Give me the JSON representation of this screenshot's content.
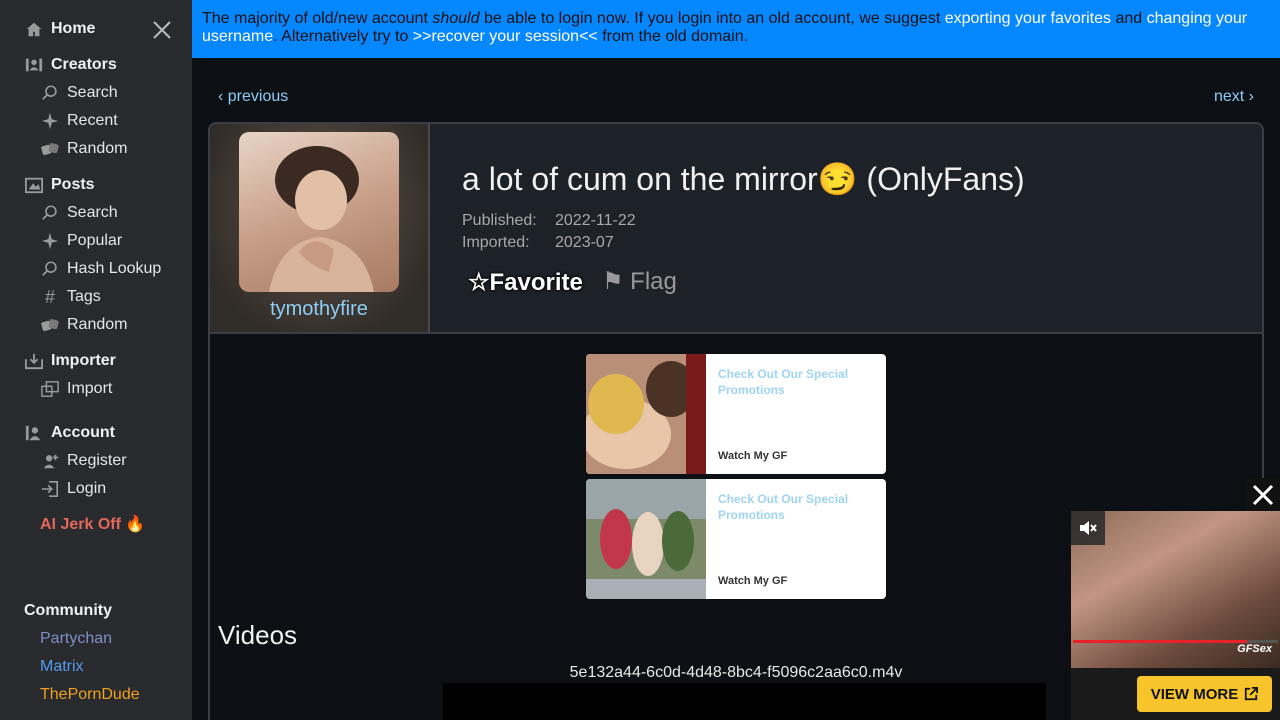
{
  "sidebar": {
    "home": "Home",
    "creators": {
      "title": "Creators",
      "items": [
        "Search",
        "Recent",
        "Random"
      ]
    },
    "posts": {
      "title": "Posts",
      "items": [
        "Search",
        "Popular",
        "Hash Lookup",
        "Tags",
        "Random"
      ]
    },
    "importer": {
      "title": "Importer",
      "items": [
        "Import"
      ]
    },
    "account": {
      "title": "Account",
      "items": [
        "Register",
        "Login"
      ]
    },
    "promo": "AI Jerk Off 🔥",
    "community": {
      "title": "Community",
      "links": [
        {
          "label": "Partychan",
          "color": "#7f8fc6"
        },
        {
          "label": "Matrix",
          "color": "#5599ee"
        },
        {
          "label": "ThePornDude",
          "color": "#f0a020"
        }
      ]
    }
  },
  "banner": {
    "t1": "The majority of old/new account ",
    "t2": "should",
    "t3": " be able to login now. If you login into an old account, we suggest ",
    "l1": "exporting your favorites",
    "t4": " and ",
    "l2": "changing your username",
    "t5": ". Alternatively try to ",
    "l3": ">>recover your session<<",
    "t6": " from the old domain."
  },
  "nav": {
    "previous": "‹ previous",
    "next": "next ›"
  },
  "post": {
    "username": "tymothyfire",
    "title": "a lot of cum on the mirror😏 (OnlyFans)",
    "published_label": "Published:",
    "published_value": "2022-11-22",
    "imported_label": "Imported:",
    "imported_value": "2023-07",
    "favorite": "☆Favorite",
    "flag": "⚑ Flag"
  },
  "ads": [
    {
      "title": "Check Out Our Special Promotions",
      "brand": "Watch My GF"
    },
    {
      "title": "Check Out Our Special Promotions",
      "brand": "Watch My GF"
    }
  ],
  "videos": {
    "heading": "Videos",
    "filename": "5e132a44-6c0d-4d48-8bc4-f5096c2aa6c0.m4v"
  },
  "float_ad": {
    "brand": "GFSex",
    "cta": "VIEW MORE",
    "progress": 0.85
  }
}
